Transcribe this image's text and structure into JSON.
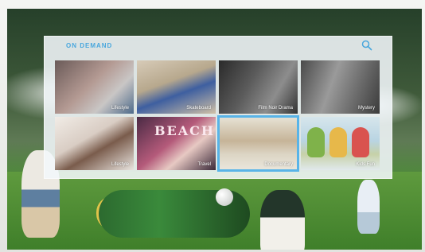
{
  "panel": {
    "title": "ON DEMAND",
    "search_icon": "search-icon"
  },
  "tiles": [
    {
      "label": "Lifestyle",
      "selected": false
    },
    {
      "label": "Skateboard",
      "selected": false
    },
    {
      "label": "Film Noir Drama",
      "selected": false
    },
    {
      "label": "Mystery",
      "selected": false
    },
    {
      "label": "Lifestyle",
      "selected": false
    },
    {
      "label": "Travel",
      "selected": false
    },
    {
      "label": "Documentary",
      "selected": true
    },
    {
      "label": "Kids Fun",
      "selected": false
    }
  ],
  "thumbnail_text": {
    "beach": "BEACH"
  },
  "colors": {
    "accent": "#49a7dd",
    "selection": "#58b4e8"
  }
}
